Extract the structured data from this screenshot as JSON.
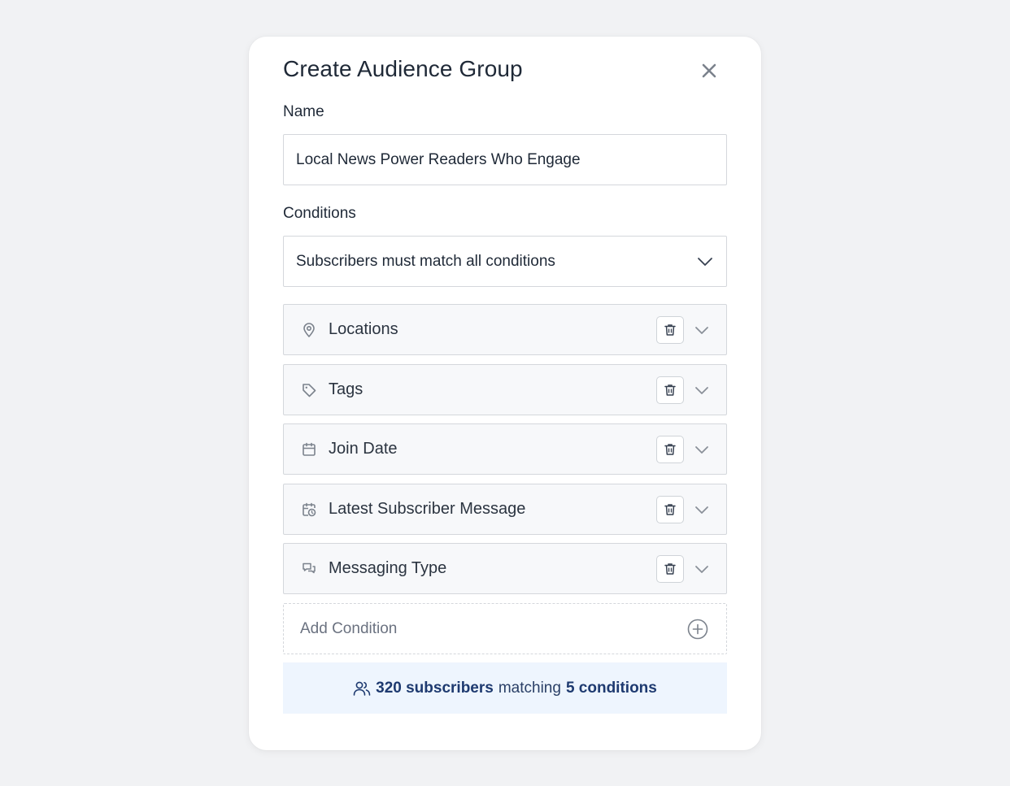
{
  "modal": {
    "title": "Create Audience Group"
  },
  "name_field": {
    "label": "Name",
    "value": "Local News Power Readers Who Engage"
  },
  "conditions_field": {
    "label": "Conditions",
    "match_mode": "Subscribers must match all conditions"
  },
  "conditions": [
    {
      "label": "Locations",
      "icon": "map-pin-icon"
    },
    {
      "label": "Tags",
      "icon": "tag-icon"
    },
    {
      "label": "Join Date",
      "icon": "calendar-icon"
    },
    {
      "label": "Latest Subscriber Message",
      "icon": "calendar-clock-icon"
    },
    {
      "label": "Messaging Type",
      "icon": "chat-bubbles-icon"
    }
  ],
  "add_condition": {
    "label": "Add Condition"
  },
  "summary": {
    "subscribers": "320 subscribers",
    "middle": "matching",
    "conditions": "5 conditions"
  },
  "colors": {
    "icon_gray": "#6b7280",
    "summary_bg": "#eef5fe",
    "summary_text": "#1e3a6e"
  }
}
